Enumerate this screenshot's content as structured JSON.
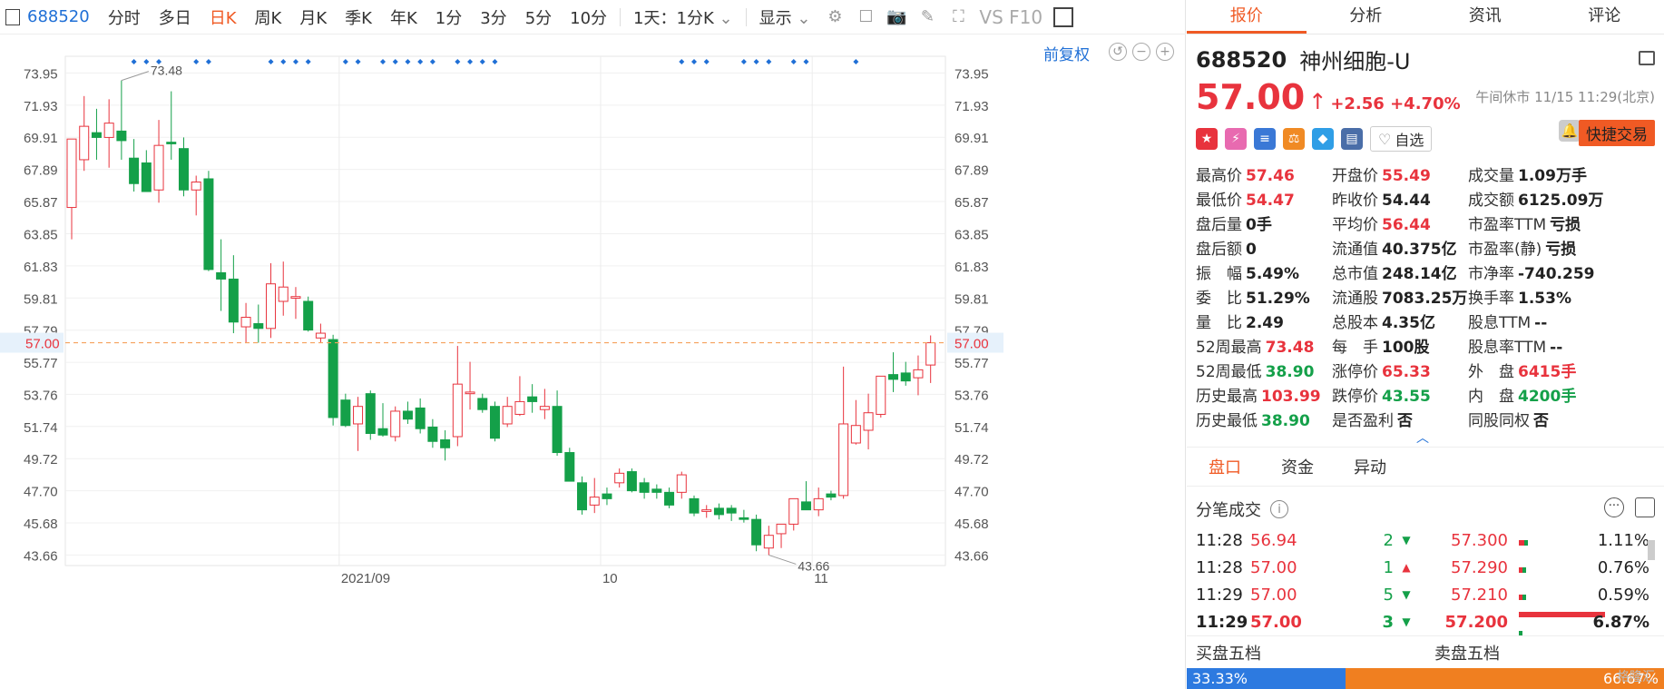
{
  "toolbar": {
    "code": "688520",
    "periods": [
      "分时",
      "多日",
      "日K",
      "周K",
      "月K",
      "季K",
      "年K",
      "1分",
      "3分",
      "5分",
      "10分"
    ],
    "active_period": "日K",
    "dropdown": "1天：1分K",
    "display": "显示",
    "f10": "VS F10"
  },
  "chart": {
    "adjust": "前复权",
    "high_label": "73.48",
    "low_label": "43.66",
    "current_price_label": "57.00",
    "y_ticks": [
      "73.95",
      "71.93",
      "69.91",
      "67.89",
      "65.87",
      "63.85",
      "61.83",
      "59.81",
      "57.79",
      "55.77",
      "53.76",
      "51.74",
      "49.72",
      "47.70",
      "45.68",
      "43.66"
    ],
    "x_labels": [
      {
        "index": 22,
        "label": "2021/09"
      },
      {
        "index": 43,
        "label": "10"
      },
      {
        "index": 60,
        "label": "11"
      }
    ],
    "colors": {
      "up": "#e8333d",
      "down": "#14a049",
      "marker": "#1f6fd6",
      "current": "#f5a25d"
    },
    "marker_candles": [
      5,
      6,
      7,
      10,
      11,
      16,
      17,
      18,
      19,
      22,
      23,
      25,
      26,
      27,
      28,
      29,
      31,
      32,
      33,
      34,
      49,
      50,
      51,
      54,
      55,
      56,
      58,
      59,
      63
    ]
  },
  "chart_data": {
    "type": "candlestick",
    "ylim": [
      43.0,
      75.0
    ],
    "candles": [
      {
        "o": 65.5,
        "h": 69.5,
        "l": 63.5,
        "c": 69.8
      },
      {
        "o": 68.5,
        "h": 72.5,
        "l": 67.8,
        "c": 70.6
      },
      {
        "o": 70.2,
        "h": 71.7,
        "l": 68.5,
        "c": 69.9
      },
      {
        "o": 69.9,
        "h": 72.3,
        "l": 68.0,
        "c": 70.8
      },
      {
        "o": 70.3,
        "h": 73.48,
        "l": 68.5,
        "c": 69.7
      },
      {
        "o": 68.6,
        "h": 69.8,
        "l": 66.5,
        "c": 67.0
      },
      {
        "o": 68.3,
        "h": 69.1,
        "l": 66.6,
        "c": 66.5
      },
      {
        "o": 66.6,
        "h": 71.0,
        "l": 65.8,
        "c": 69.4
      },
      {
        "o": 69.6,
        "h": 72.8,
        "l": 68.5,
        "c": 69.5
      },
      {
        "o": 69.2,
        "h": 69.9,
        "l": 66.2,
        "c": 66.6
      },
      {
        "o": 66.6,
        "h": 67.5,
        "l": 65.0,
        "c": 67.1
      },
      {
        "o": 67.3,
        "h": 67.8,
        "l": 61.5,
        "c": 61.6
      },
      {
        "o": 61.4,
        "h": 63.5,
        "l": 59.0,
        "c": 61.0
      },
      {
        "o": 61.0,
        "h": 62.5,
        "l": 57.6,
        "c": 58.3
      },
      {
        "o": 58.0,
        "h": 59.5,
        "l": 57.0,
        "c": 58.6
      },
      {
        "o": 58.2,
        "h": 59.4,
        "l": 57.0,
        "c": 57.9
      },
      {
        "o": 57.9,
        "h": 62.0,
        "l": 57.3,
        "c": 60.7
      },
      {
        "o": 59.6,
        "h": 62.1,
        "l": 58.7,
        "c": 60.5
      },
      {
        "o": 59.8,
        "h": 60.5,
        "l": 58.5,
        "c": 59.9
      },
      {
        "o": 59.6,
        "h": 59.9,
        "l": 57.7,
        "c": 57.8
      },
      {
        "o": 57.3,
        "h": 58.2,
        "l": 57.0,
        "c": 57.6
      },
      {
        "o": 57.2,
        "h": 57.5,
        "l": 51.8,
        "c": 52.3
      },
      {
        "o": 53.4,
        "h": 53.8,
        "l": 51.7,
        "c": 51.8
      },
      {
        "o": 51.9,
        "h": 53.6,
        "l": 50.2,
        "c": 53.0
      },
      {
        "o": 53.8,
        "h": 54.0,
        "l": 50.9,
        "c": 51.3
      },
      {
        "o": 51.6,
        "h": 53.2,
        "l": 51.1,
        "c": 51.2
      },
      {
        "o": 51.1,
        "h": 53.0,
        "l": 50.8,
        "c": 52.7
      },
      {
        "o": 52.7,
        "h": 53.3,
        "l": 51.9,
        "c": 52.2
      },
      {
        "o": 52.9,
        "h": 53.5,
        "l": 51.3,
        "c": 51.6
      },
      {
        "o": 51.7,
        "h": 52.2,
        "l": 50.4,
        "c": 50.8
      },
      {
        "o": 50.9,
        "h": 51.5,
        "l": 49.6,
        "c": 50.4
      },
      {
        "o": 51.1,
        "h": 56.8,
        "l": 50.5,
        "c": 54.4
      },
      {
        "o": 53.8,
        "h": 55.8,
        "l": 52.8,
        "c": 53.9
      },
      {
        "o": 53.5,
        "h": 53.8,
        "l": 52.6,
        "c": 52.8
      },
      {
        "o": 53.0,
        "h": 53.3,
        "l": 50.8,
        "c": 51.0
      },
      {
        "o": 51.9,
        "h": 53.6,
        "l": 51.7,
        "c": 53.0
      },
      {
        "o": 52.5,
        "h": 54.9,
        "l": 52.4,
        "c": 53.3
      },
      {
        "o": 53.6,
        "h": 54.4,
        "l": 52.6,
        "c": 53.3
      },
      {
        "o": 52.8,
        "h": 54.1,
        "l": 52.2,
        "c": 53.0
      },
      {
        "o": 53.0,
        "h": 54.0,
        "l": 49.9,
        "c": 50.1
      },
      {
        "o": 50.1,
        "h": 50.4,
        "l": 48.4,
        "c": 48.3
      },
      {
        "o": 48.2,
        "h": 48.6,
        "l": 46.2,
        "c": 46.5
      },
      {
        "o": 46.8,
        "h": 48.5,
        "l": 46.3,
        "c": 47.3
      },
      {
        "o": 47.5,
        "h": 47.9,
        "l": 46.8,
        "c": 47.2
      },
      {
        "o": 48.2,
        "h": 49.1,
        "l": 47.9,
        "c": 48.8
      },
      {
        "o": 48.9,
        "h": 49.1,
        "l": 47.6,
        "c": 47.7
      },
      {
        "o": 48.2,
        "h": 48.5,
        "l": 47.2,
        "c": 47.6
      },
      {
        "o": 47.8,
        "h": 48.1,
        "l": 47.2,
        "c": 47.6
      },
      {
        "o": 47.6,
        "h": 47.9,
        "l": 46.6,
        "c": 46.8
      },
      {
        "o": 47.6,
        "h": 48.9,
        "l": 47.2,
        "c": 48.7
      },
      {
        "o": 47.2,
        "h": 47.4,
        "l": 46.1,
        "c": 46.3
      },
      {
        "o": 46.4,
        "h": 46.8,
        "l": 46.0,
        "c": 46.5
      },
      {
        "o": 46.6,
        "h": 46.9,
        "l": 45.9,
        "c": 46.2
      },
      {
        "o": 46.6,
        "h": 46.8,
        "l": 45.8,
        "c": 46.3
      },
      {
        "o": 46.0,
        "h": 46.5,
        "l": 45.7,
        "c": 45.9
      },
      {
        "o": 45.9,
        "h": 46.2,
        "l": 43.9,
        "c": 44.3
      },
      {
        "o": 44.1,
        "h": 45.5,
        "l": 43.66,
        "c": 44.9
      },
      {
        "o": 45.0,
        "h": 45.6,
        "l": 44.1,
        "c": 45.6
      },
      {
        "o": 45.6,
        "h": 47.1,
        "l": 45.2,
        "c": 47.2
      },
      {
        "o": 47.0,
        "h": 48.3,
        "l": 46.6,
        "c": 46.5
      },
      {
        "o": 46.5,
        "h": 47.9,
        "l": 46.1,
        "c": 47.2
      },
      {
        "o": 47.5,
        "h": 47.7,
        "l": 47.1,
        "c": 47.3
      },
      {
        "o": 47.4,
        "h": 55.5,
        "l": 47.2,
        "c": 51.9
      },
      {
        "o": 50.7,
        "h": 53.4,
        "l": 50.6,
        "c": 51.8
      },
      {
        "o": 51.5,
        "h": 53.8,
        "l": 50.3,
        "c": 52.6
      },
      {
        "o": 52.5,
        "h": 54.9,
        "l": 52.3,
        "c": 54.9
      },
      {
        "o": 55.0,
        "h": 56.4,
        "l": 53.9,
        "c": 54.7
      },
      {
        "o": 55.1,
        "h": 55.8,
        "l": 54.3,
        "c": 54.6
      },
      {
        "o": 54.8,
        "h": 56.2,
        "l": 53.7,
        "c": 55.3
      },
      {
        "o": 55.6,
        "h": 57.46,
        "l": 54.47,
        "c": 57.0
      }
    ]
  },
  "side": {
    "tabs": [
      "报价",
      "分析",
      "资讯",
      "评论"
    ],
    "active_tab": "报价",
    "code": "688520",
    "name": "神州细胞-U",
    "price": "57.00",
    "change": "+2.56",
    "change_pct": "+4.70%",
    "status": "午间休市 11/15 11:29(北京)",
    "watch": "自选",
    "trade": "快捷交易",
    "stats": [
      [
        {
          "l": "最高价",
          "v": "57.46",
          "c": "red"
        },
        {
          "l": "开盘价",
          "v": "55.49",
          "c": "red"
        },
        {
          "l": "成交量",
          "v": "1.09万手",
          "c": "dark"
        }
      ],
      [
        {
          "l": "最低价",
          "v": "54.47",
          "c": "red"
        },
        {
          "l": "昨收价",
          "v": "54.44",
          "c": "dark"
        },
        {
          "l": "成交额",
          "v": "6125.09万",
          "c": "dark"
        }
      ],
      [
        {
          "l": "盘后量",
          "v": "0手",
          "c": "dark"
        },
        {
          "l": "平均价",
          "v": "56.44",
          "c": "red"
        },
        {
          "l": "市盈率TTM",
          "v": "亏损",
          "c": "dark"
        }
      ],
      [
        {
          "l": "盘后额",
          "v": "0",
          "c": "dark"
        },
        {
          "l": "流通值",
          "v": "40.375亿",
          "c": "dark"
        },
        {
          "l": "市盈率(静)",
          "v": "亏损",
          "c": "dark"
        }
      ],
      [
        {
          "l": "振　幅",
          "v": "5.49%",
          "c": "dark"
        },
        {
          "l": "总市值",
          "v": "248.14亿",
          "c": "dark"
        },
        {
          "l": "市净率",
          "v": "-740.259",
          "c": "dark"
        }
      ],
      [
        {
          "l": "委　比",
          "v": "51.29%",
          "c": "dark"
        },
        {
          "l": "流通股",
          "v": "7083.25万",
          "c": "dark"
        },
        {
          "l": "换手率",
          "v": "1.53%",
          "c": "dark"
        }
      ],
      [
        {
          "l": "量　比",
          "v": "2.49",
          "c": "dark"
        },
        {
          "l": "总股本",
          "v": "4.35亿",
          "c": "dark"
        },
        {
          "l": "股息TTM",
          "v": "--",
          "c": "dark"
        }
      ],
      [
        {
          "l": "52周最高",
          "v": "73.48",
          "c": "red"
        },
        {
          "l": "每　手",
          "v": "100股",
          "c": "dark"
        },
        {
          "l": "股息率TTM",
          "v": "--",
          "c": "dark"
        }
      ],
      [
        {
          "l": "52周最低",
          "v": "38.90",
          "c": "green"
        },
        {
          "l": "涨停价",
          "v": "65.33",
          "c": "red"
        },
        {
          "l": "外　盘",
          "v": "6415手",
          "c": "red"
        }
      ],
      [
        {
          "l": "历史最高",
          "v": "103.99",
          "c": "red"
        },
        {
          "l": "跌停价",
          "v": "43.55",
          "c": "green"
        },
        {
          "l": "内　盘",
          "v": "4200手",
          "c": "green"
        }
      ],
      [
        {
          "l": "历史最低",
          "v": "38.90",
          "c": "green"
        },
        {
          "l": "是否盈利",
          "v": "否",
          "c": "dark"
        },
        {
          "l": "同股同权",
          "v": "否",
          "c": "dark"
        }
      ]
    ],
    "subtabs": [
      "盘口",
      "资金",
      "异动"
    ],
    "ticks_title": "分笔成交",
    "ticks": [
      {
        "time": "11:28",
        "price": "56.94",
        "vol": "2",
        "dir": "down",
        "p2": "57.300",
        "pct": "1.11%",
        "bar": 0.06
      },
      {
        "time": "11:28",
        "price": "57.00",
        "vol": "1",
        "dir": "up",
        "p2": "57.290",
        "pct": "0.76%",
        "bar": 0.04
      },
      {
        "time": "11:29",
        "price": "57.00",
        "vol": "5",
        "dir": "down",
        "p2": "57.210",
        "pct": "0.59%",
        "bar": 0.03
      },
      {
        "time": "11:29",
        "price": "57.00",
        "vol": "3",
        "dir": "down",
        "p2": "57.200",
        "pct": "6.87%",
        "bar": 0.95
      }
    ],
    "book_buy": "买盘五档",
    "book_sell": "卖盘五档",
    "buy_ratio": "33.33%",
    "sell_ratio": "66.67%",
    "watermark": "格隆汇"
  }
}
